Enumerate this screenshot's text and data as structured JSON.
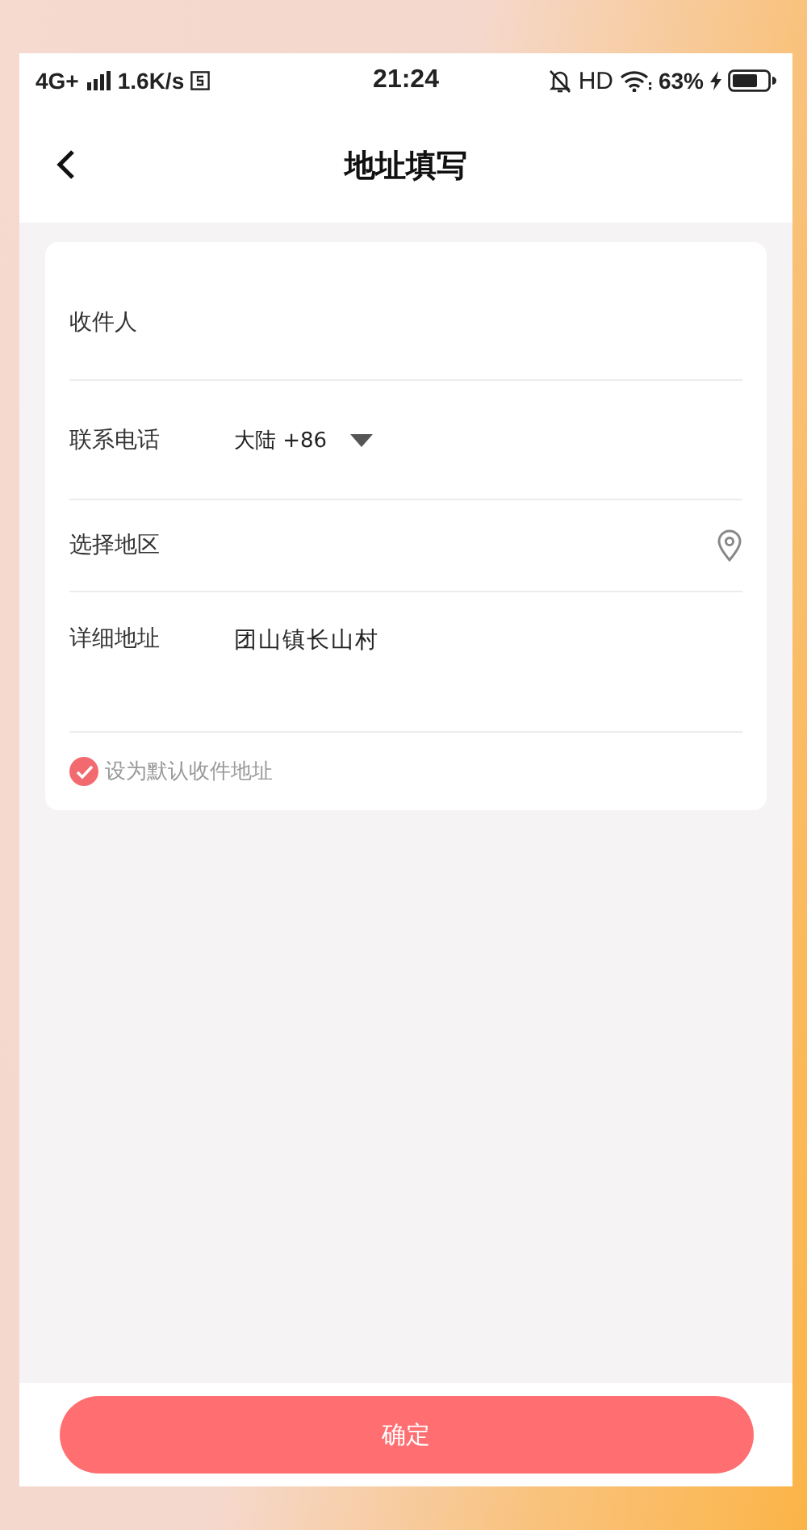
{
  "status_bar": {
    "network": "4G+",
    "speed": "1.6K/s",
    "time": "21:24",
    "hd": "HD",
    "battery": "63%"
  },
  "header": {
    "title": "地址填写"
  },
  "form": {
    "rows": [
      {
        "kind": "text",
        "label": "收件人"
      },
      {
        "kind": "phone",
        "label": "联系电话",
        "country_code": "大陆 +86"
      },
      {
        "kind": "region",
        "label": "选择地区"
      },
      {
        "kind": "address",
        "label": "详细地址",
        "value": "团山镇长山村"
      }
    ]
  },
  "default_address": {
    "label": "设为默认收件地址",
    "checked": true
  },
  "footer": {
    "button": "确定"
  }
}
